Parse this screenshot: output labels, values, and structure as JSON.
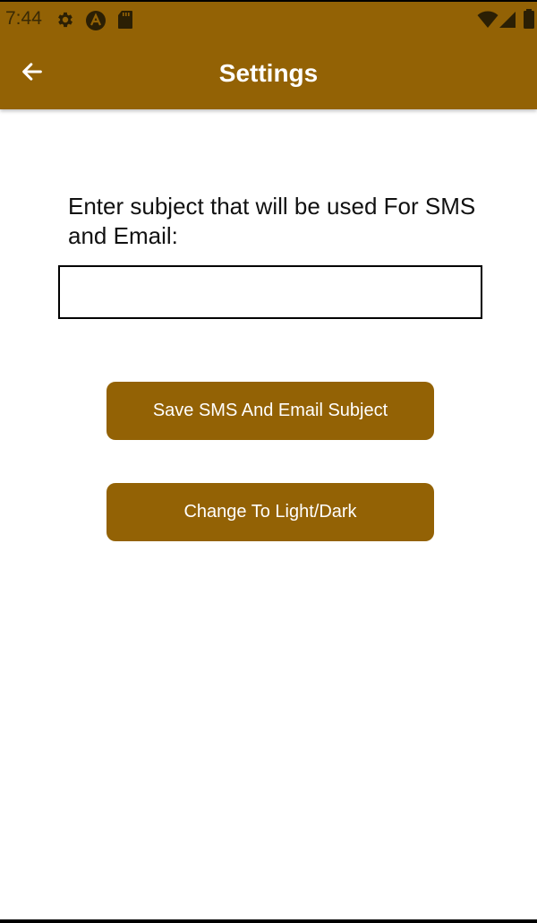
{
  "status_bar": {
    "time": "7:44",
    "icons": [
      "gear-icon",
      "app-a-icon",
      "sd-card-icon",
      "wifi-icon",
      "signal-icon",
      "battery-icon"
    ]
  },
  "app_bar": {
    "title": "Settings",
    "back_icon": "arrow-left-icon"
  },
  "form": {
    "prompt": "Enter subject that will be used For SMS and Email:",
    "subject_value": "",
    "subject_placeholder": ""
  },
  "buttons": {
    "save_label": "Save SMS And Email Subject",
    "theme_label": "Change To Light/Dark"
  },
  "colors": {
    "accent": "#936205",
    "text_on_accent": "#ffffff",
    "background": "#ffffff"
  }
}
